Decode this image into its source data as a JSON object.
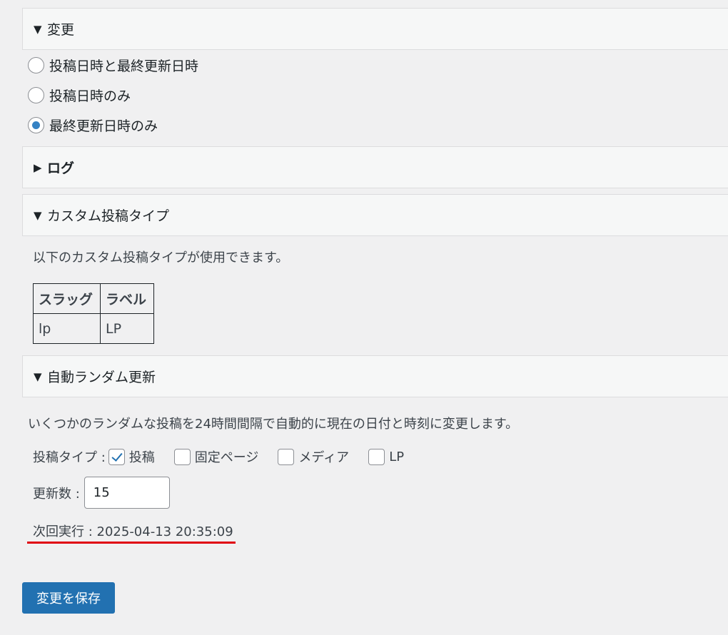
{
  "sections": {
    "change": {
      "arrow": "▼",
      "label": "変更"
    },
    "log": {
      "arrow": "▶",
      "label": "ログ"
    },
    "custom_post_type": {
      "arrow": "▼",
      "label": "カスタム投稿タイプ"
    },
    "auto_random": {
      "arrow": "▼",
      "label": "自動ランダム更新"
    }
  },
  "change_options": [
    {
      "label": "投稿日時と最終更新日時",
      "checked": false
    },
    {
      "label": "投稿日時のみ",
      "checked": false
    },
    {
      "label": "最終更新日時のみ",
      "checked": true
    }
  ],
  "custom_post_type": {
    "description": "以下のカスタム投稿タイプが使用できます。",
    "table": {
      "headers": [
        "スラッグ",
        "ラベル"
      ],
      "rows": [
        [
          "lp",
          "LP"
        ]
      ]
    }
  },
  "auto_random": {
    "description": "いくつかのランダムな投稿を24時間間隔で自動的に現在の日付と時刻に変更します。",
    "post_type_label": "投稿タイプ :",
    "post_types": [
      {
        "label": "投稿",
        "checked": true
      },
      {
        "label": "固定ページ",
        "checked": false
      },
      {
        "label": "メディア",
        "checked": false
      },
      {
        "label": "LP",
        "checked": false
      }
    ],
    "count_label": "更新数 :",
    "count_value": "15",
    "next_run_label": "次回実行 : 2025-04-13 20:35:09",
    "highlight_color": "#e0000f"
  },
  "save_button": "変更を保存",
  "colors": {
    "primary": "#2271b1",
    "radio_checked": "#3582c4",
    "background": "#f0f0f1"
  }
}
